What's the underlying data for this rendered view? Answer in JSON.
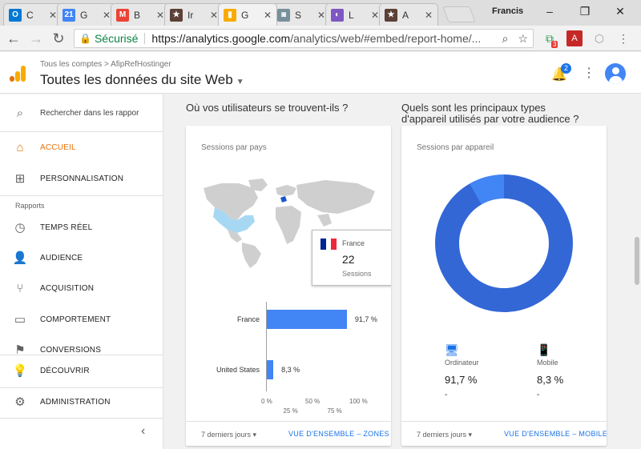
{
  "browser": {
    "tabs": [
      {
        "label": "C",
        "fav": "O",
        "color": "#0078d4"
      },
      {
        "label": "G",
        "fav": "21",
        "color": "#4285f4"
      },
      {
        "label": "B",
        "fav": "M",
        "color": "#ea4335"
      },
      {
        "label": "Ir",
        "fav": "★",
        "color": "#5d4037"
      },
      {
        "label": "G",
        "fav": "▮",
        "color": "#f9ab00"
      },
      {
        "label": "S",
        "fav": "◙",
        "color": "#78909c"
      },
      {
        "label": "L",
        "fav": "◐",
        "color": "#7e57c2"
      },
      {
        "label": "A",
        "fav": "★",
        "color": "#5d4037"
      }
    ],
    "user": "Francis",
    "secure_label": "Sécurisé",
    "url_domain": "https://analytics.google.com",
    "url_path": "/analytics/web/#embed/report-home/...",
    "extension_badge": "3"
  },
  "ga": {
    "breadcrumb": "Tous les comptes > AfipRefHostinger",
    "property_title": "Toutes les données du site Web",
    "notifications": "2"
  },
  "sidebar": {
    "search_label": "Rechercher dans les rappor",
    "home": "ACCUEIL",
    "customization": "PERSONNALISATION",
    "reports_heading": "Rapports",
    "realtime": "TEMPS RÉEL",
    "audience": "AUDIENCE",
    "acquisition": "ACQUISITION",
    "behavior": "COMPORTEMENT",
    "conversions": "CONVERSIONS",
    "discover": "DÉCOUVRIR",
    "admin": "ADMINISTRATION"
  },
  "location_card": {
    "question": "Où vos utilisateurs se trouvent-ils ?",
    "title": "Sessions par pays",
    "tooltip": {
      "country": "France",
      "value": "22",
      "label": "Sessions"
    },
    "bars": [
      {
        "label": "France",
        "percent": 91.7,
        "value_label": "91,7 %"
      },
      {
        "label": "United States",
        "percent": 8.3,
        "value_label": "8,3 %"
      }
    ],
    "ticks": [
      "0 %",
      "25 %",
      "50 %",
      "75 %",
      "100 %"
    ],
    "range": "7 derniers jours",
    "overview": "VUE D'ENSEMBLE – ZONES"
  },
  "device_card": {
    "question_line1": "Quels sont les principaux types",
    "question_line2": "d'appareil utilisés par votre audience ?",
    "title": "Sessions par appareil",
    "desktop": {
      "label": "Ordinateur",
      "value": "91,7 %",
      "share": 91.7,
      "dash": "-"
    },
    "mobile": {
      "label": "Mobile",
      "value": "8,3 %",
      "share": 8.3,
      "dash": "-"
    },
    "range": "7 derniers jours",
    "overview": "VUE D'ENSEMBLE – MOBILE"
  }
}
